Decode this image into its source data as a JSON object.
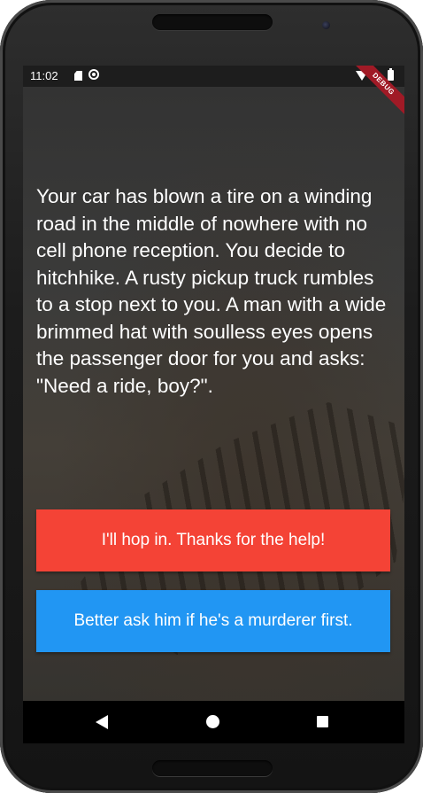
{
  "status_bar": {
    "time": "11:02",
    "icons": [
      "sd-card-icon",
      "sync-icon",
      "wifi-icon",
      "battery-icon"
    ],
    "debug_banner": "DEBUG"
  },
  "story": {
    "text": "Your car has blown a tire on a winding road in the middle of nowhere with no cell phone reception. You decide to hitchhike. A rusty pickup truck rumbles to a stop next to you. A man with a wide brimmed hat with soulless eyes opens the passenger door for you and asks: \"Need a ride, boy?\"."
  },
  "choices": [
    {
      "label": "I'll hop in. Thanks for the help!",
      "color": "#f44336"
    },
    {
      "label": "Better ask him if he's a murderer first.",
      "color": "#2196f3"
    }
  ],
  "nav_bar": {
    "icons": [
      "back-icon",
      "home-icon",
      "recents-icon"
    ]
  }
}
